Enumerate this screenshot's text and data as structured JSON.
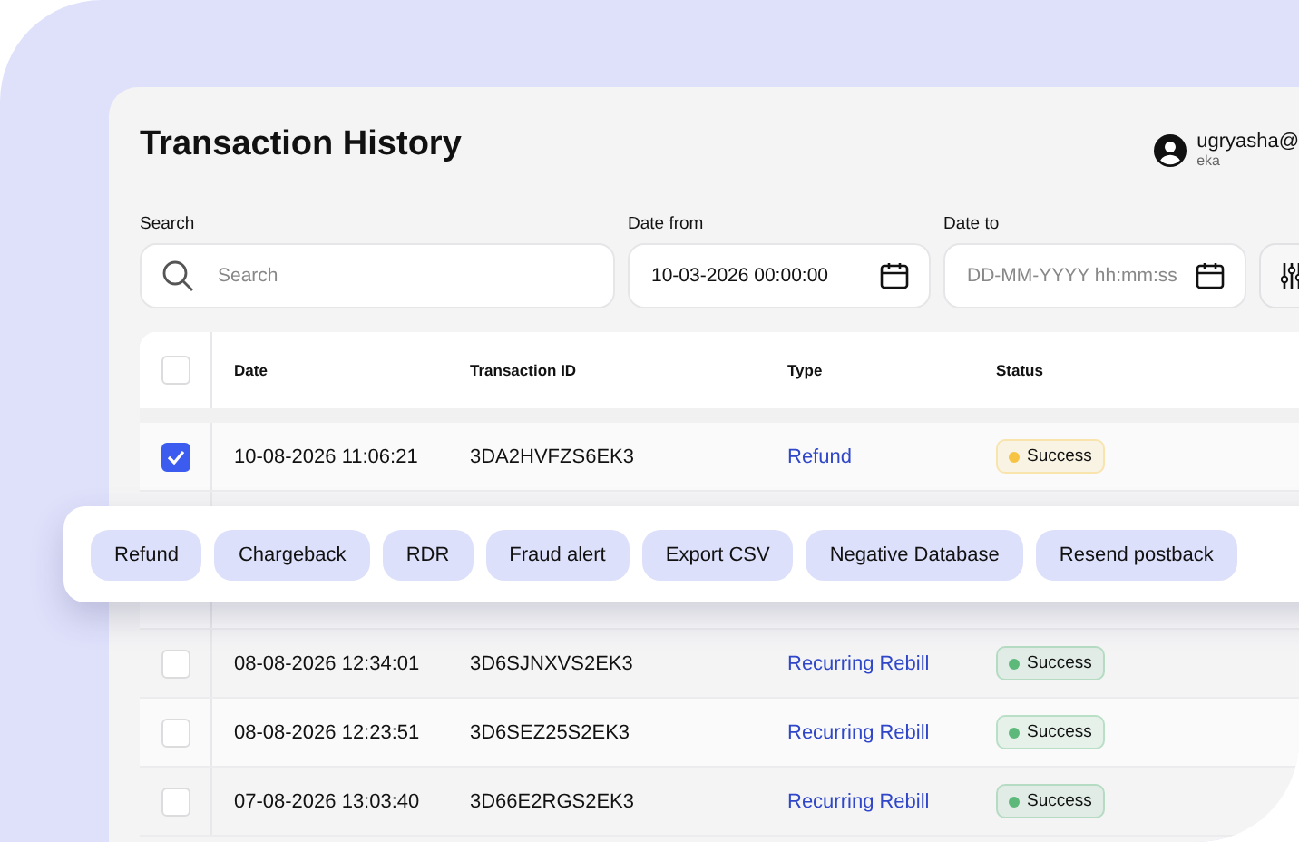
{
  "header": {
    "title": "Transaction History",
    "user": {
      "email": "ugryasha@",
      "name": "eka"
    }
  },
  "filters": {
    "search": {
      "label": "Search",
      "placeholder": "Search"
    },
    "date_from": {
      "label": "Date from",
      "value": "10-03-2026 00:00:00"
    },
    "date_to": {
      "label": "Date to",
      "placeholder": "DD-MM-YYYY hh:mm:ss"
    }
  },
  "table": {
    "select_all": {
      "checked": false
    },
    "columns": [
      "Date",
      "Transaction ID",
      "Type",
      "Status"
    ],
    "rows": [
      {
        "kind": "row",
        "checked": true,
        "date": "10-08-2026 11:06:21",
        "id": "3DA2HVFZS6EK3",
        "type": "Refund",
        "status": "Success",
        "color": "#f6c343"
      },
      {
        "kind": "covered"
      },
      {
        "kind": "covered"
      },
      {
        "kind": "row",
        "checked": false,
        "date": "08-08-2026 12:34:01",
        "id": "3D6SJNXVS2EK3",
        "type": "Recurring Rebill",
        "status": "Success",
        "color": "#5cb97a"
      },
      {
        "kind": "row",
        "checked": false,
        "date": "08-08-2026 12:23:51",
        "id": "3D6SEZ25S2EK3",
        "type": "Recurring Rebill",
        "status": "Success",
        "color": "#5cb97a"
      },
      {
        "kind": "row",
        "checked": false,
        "date": "07-08-2026 13:03:40",
        "id": "3D66E2RGS2EK3",
        "type": "Recurring Rebill",
        "status": "Success",
        "color": "#5cb97a"
      }
    ]
  },
  "actions": [
    "Refund",
    "Chargeback",
    "RDR",
    "Fraud alert",
    "Export CSV",
    "Negative Database",
    "Resend postback"
  ]
}
